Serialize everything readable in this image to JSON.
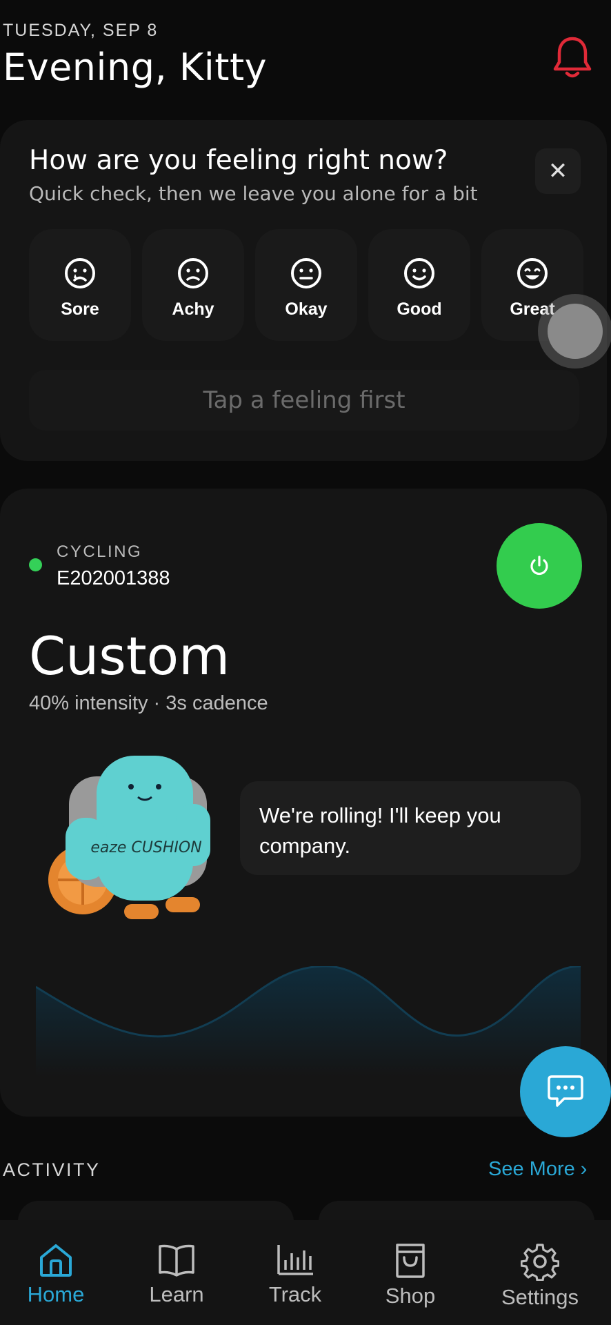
{
  "header": {
    "date": "TUESDAY, SEP 8",
    "greeting": "Evening, Kitty",
    "bell_icon": "bell-icon",
    "bell_color": "#e02a38"
  },
  "feeling_card": {
    "question": "How are you feeling right now?",
    "subtitle": "Quick check, then we leave you alone for a bit",
    "close_icon": "close-icon",
    "moods": [
      {
        "label": "Sore",
        "icon": "sore-face-icon"
      },
      {
        "label": "Achy",
        "icon": "achy-face-icon"
      },
      {
        "label": "Okay",
        "icon": "okay-face-icon"
      },
      {
        "label": "Good",
        "icon": "good-face-icon"
      },
      {
        "label": "Great",
        "icon": "great-face-icon"
      }
    ],
    "submit_label": "Tap a feeling first"
  },
  "device_card": {
    "status_color": "#34d058",
    "mode_label": "CYCLING",
    "device_id": "E202001388",
    "power_icon": "power-icon",
    "program_name": "Custom",
    "program_details": "40% intensity · 3s cadence",
    "mascot_message": "We're rolling! I'll keep you company.",
    "mascot_text": "eaze CUSHION"
  },
  "chat_icon": "chat-icon",
  "activity": {
    "title": "ACTIVITY",
    "see_more": "See More ›"
  },
  "bottom_nav": [
    {
      "label": "Home",
      "icon": "home-icon",
      "active": true
    },
    {
      "label": "Learn",
      "icon": "book-icon",
      "active": false
    },
    {
      "label": "Track",
      "icon": "chart-icon",
      "active": false
    },
    {
      "label": "Shop",
      "icon": "shopping-bag-icon",
      "active": false
    },
    {
      "label": "Settings",
      "icon": "gear-icon",
      "active": false
    }
  ],
  "colors": {
    "accent": "#2aa8d6",
    "power": "#33cc4e",
    "background": "#0b0b0b"
  }
}
